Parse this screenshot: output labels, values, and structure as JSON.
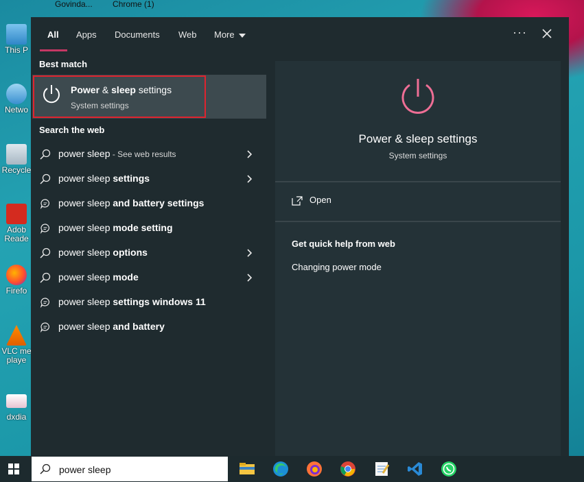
{
  "desktop": {
    "topbar": [
      "Govinda...",
      "Chrome (1)"
    ],
    "icons": [
      {
        "label1": "This P",
        "label2": ""
      },
      {
        "label1": "Netwo",
        "label2": ""
      },
      {
        "label1": "Recycle",
        "label2": ""
      },
      {
        "label1": "Adob",
        "label2": "Reade"
      },
      {
        "label1": "Firefo",
        "label2": ""
      },
      {
        "label1": "VLC me",
        "label2": "playe"
      },
      {
        "label1": "dxdia",
        "label2": ""
      }
    ]
  },
  "start": {
    "tabs": [
      "All",
      "Apps",
      "Documents",
      "Web",
      "More"
    ],
    "more_icon": "chevron-down-icon",
    "best_match_heading": "Best match",
    "best_match": {
      "title_part1": "Power",
      "title_part2": " & ",
      "title_part3": "sleep",
      "title_part4": " settings",
      "subtitle": "System settings"
    },
    "search_web_heading": "Search the web",
    "suggestions": [
      {
        "base": "power sleep",
        "bold": "",
        "suffix": " - See web results",
        "icon": "search-icon",
        "arrow": true
      },
      {
        "base": "power sleep ",
        "bold": "settings",
        "suffix": "",
        "icon": "search-icon",
        "arrow": true
      },
      {
        "base": "power sleep ",
        "bold": "and battery settings",
        "suffix": "",
        "icon": "chat-icon",
        "arrow": false
      },
      {
        "base": "power sleep ",
        "bold": "mode setting",
        "suffix": "",
        "icon": "chat-icon",
        "arrow": false
      },
      {
        "base": "power sleep ",
        "bold": "options",
        "suffix": "",
        "icon": "search-icon",
        "arrow": true
      },
      {
        "base": "power sleep ",
        "bold": "mode",
        "suffix": "",
        "icon": "search-icon",
        "arrow": true
      },
      {
        "base": "power sleep ",
        "bold": "settings windows 11",
        "suffix": "",
        "icon": "chat-icon",
        "arrow": false
      },
      {
        "base": "power sleep ",
        "bold": "and battery",
        "suffix": "",
        "icon": "chat-icon",
        "arrow": false
      }
    ],
    "preview": {
      "title": "Power & sleep settings",
      "subtitle": "System settings",
      "open_label": "Open",
      "quick_help_heading": "Get quick help from web",
      "quick_help_link": "Changing power mode"
    }
  },
  "taskbar": {
    "search_value": "power sleep",
    "apps": [
      "file-explorer-icon",
      "edge-icon",
      "firefox-icon",
      "chrome-icon",
      "notepad-icon",
      "vscode-icon",
      "whatsapp-icon"
    ]
  },
  "colors": {
    "accent": "#c53864",
    "highlight_border": "#e0232e",
    "power_icon": "#ee6e95"
  }
}
